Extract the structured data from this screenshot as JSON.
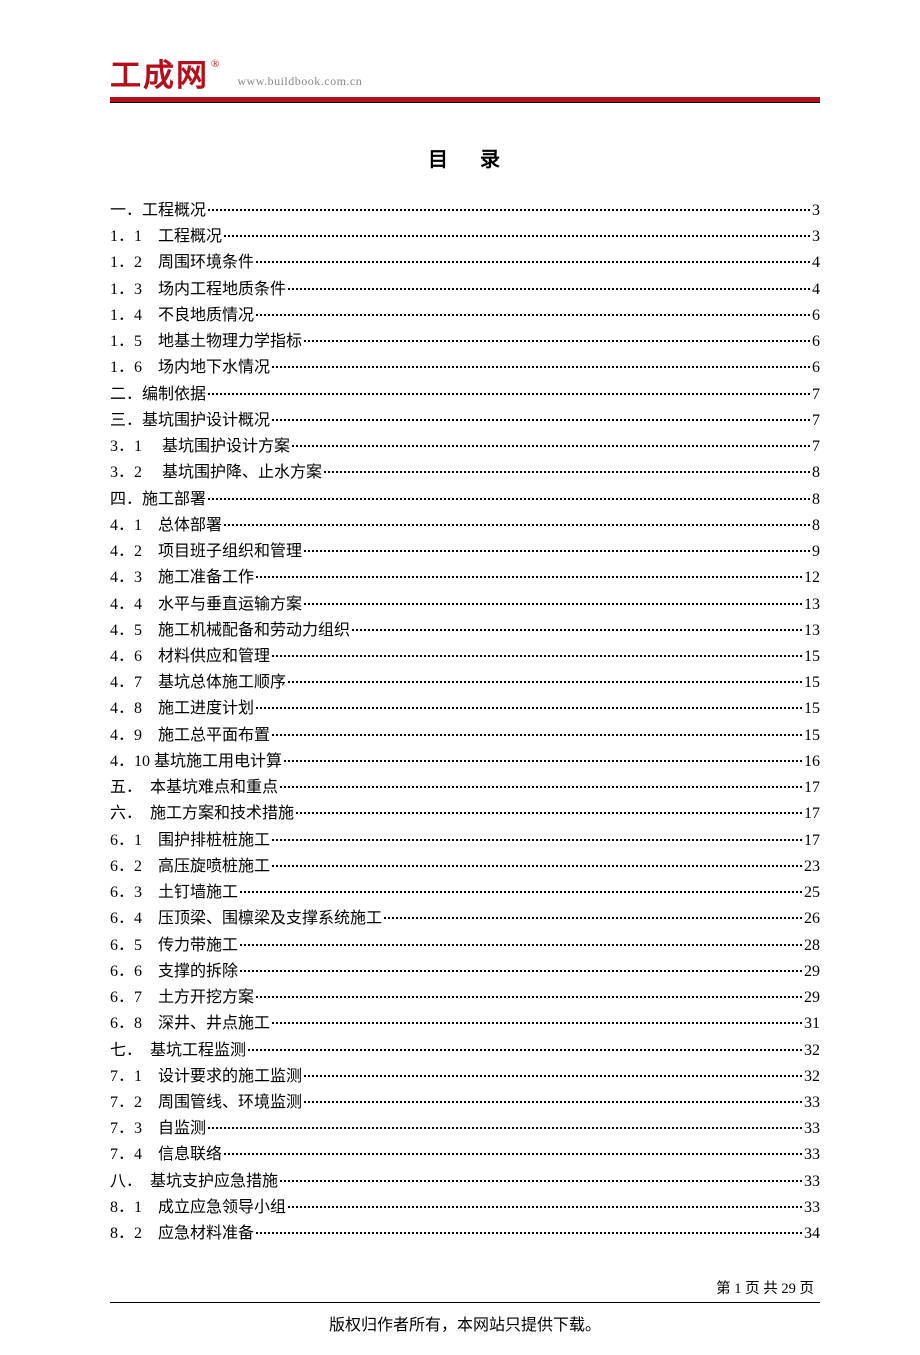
{
  "brand": {
    "logo_text": "工成网",
    "reg_mark": "®",
    "url": "www.buildbook.com.cn"
  },
  "title": "目录",
  "toc": [
    {
      "label": "一．工程概况",
      "page": "3",
      "indent": 1
    },
    {
      "label": "1．1　工程概况",
      "page": "3",
      "indent": 1
    },
    {
      "label": " 1．2　周围环境条件",
      "page": " 4",
      "indent": 1
    },
    {
      "label": "1．3　场内工程地质条件",
      "page": "4",
      "indent": 1
    },
    {
      "label": "1．4　不良地质情况",
      "page": "6",
      "indent": 1
    },
    {
      "label": "1．5　地基土物理力学指标",
      "page": "6",
      "indent": 1
    },
    {
      "label": "1．6　场内地下水情况",
      "page": "6",
      "indent": 1
    },
    {
      "label": "二．编制依据",
      "page": "7",
      "indent": 1
    },
    {
      "label": "三．基坑围护设计概况",
      "page": "7",
      "indent": 1
    },
    {
      "label": "3．1　 基坑围护设计方案",
      "page": " 7",
      "indent": 1
    },
    {
      "label": "3．2　 基坑围护降、止水方案",
      "page": " 8",
      "indent": 1
    },
    {
      "label": "四．施工部署",
      "page": "8",
      "indent": 1
    },
    {
      "label": "4．1　总体部署 ",
      "page": " 8",
      "indent": 1
    },
    {
      "label": "4．2　项目班子组织和管理",
      "page": "9",
      "indent": 1
    },
    {
      "label": "4．3　施工准备工作",
      "page": "12",
      "indent": 1
    },
    {
      "label": "4．4　水平与垂直运输方案",
      "page": "13",
      "indent": 1
    },
    {
      "label": "4．5　施工机械配备和劳动力组织",
      "page": "13",
      "indent": 1
    },
    {
      "label": "4．6　材料供应和管理",
      "page": "15",
      "indent": 1
    },
    {
      "label": "4．7　基坑总体施工顺序",
      "page": "15",
      "indent": 1
    },
    {
      "label": "4．8　施工进度计划",
      "page": "15",
      "indent": 1
    },
    {
      "label": "4．9　施工总平面布置",
      "page": "15",
      "indent": 1
    },
    {
      "label": "4．10 基坑施工用电计算",
      "page": "16",
      "indent": 1
    },
    {
      "label": "五．　本基坑难点和重点",
      "page": "17",
      "indent": 1
    },
    {
      "label": "六．　施工方案和技术措施",
      "page": "17",
      "indent": 1
    },
    {
      "label": "6．1　围护排桩桩施工",
      "page": "17",
      "indent": 1
    },
    {
      "label": "6．2　高压旋喷桩施工",
      "page": "23",
      "indent": 1
    },
    {
      "label": "6．3　土钉墙施工",
      "page": "25",
      "indent": 1
    },
    {
      "label": "6．4　压顶梁、围檩梁及支撑系统施工",
      "page": "26",
      "indent": 1
    },
    {
      "label": "6．5　传力带施工",
      "page": "28",
      "indent": 1
    },
    {
      "label": "6．6　支撑的拆除",
      "page": "29",
      "indent": 1
    },
    {
      "label": "6．7　土方开挖方案",
      "page": "29",
      "indent": 1
    },
    {
      "label": "6．8　深井、井点施工",
      "page": "31",
      "indent": 1
    },
    {
      "label": "七．　基坑工程监测",
      "page": "32",
      "indent": 1
    },
    {
      "label": "7．1　设计要求的施工监测",
      "page": "32",
      "indent": 1
    },
    {
      "label": "7．2　周围管线、环境监测",
      "page": "33",
      "indent": 1
    },
    {
      "label": "7．3　自监测",
      "page": "33",
      "indent": 1
    },
    {
      "label": "7．4　信息联络",
      "page": "33",
      "indent": 1
    },
    {
      "label": "八．　基坑支护应急措施",
      "page": "33",
      "indent": 1
    },
    {
      "label": "8．1　成立应急领导小组",
      "page": "33",
      "indent": 1
    },
    {
      "label": "8．2　应急材料准备",
      "page": "34",
      "indent": 1
    }
  ],
  "footer": {
    "page_number": "第 1 页 共 29 页",
    "copyright": "版权归作者所有，本网站只提供下载。"
  }
}
